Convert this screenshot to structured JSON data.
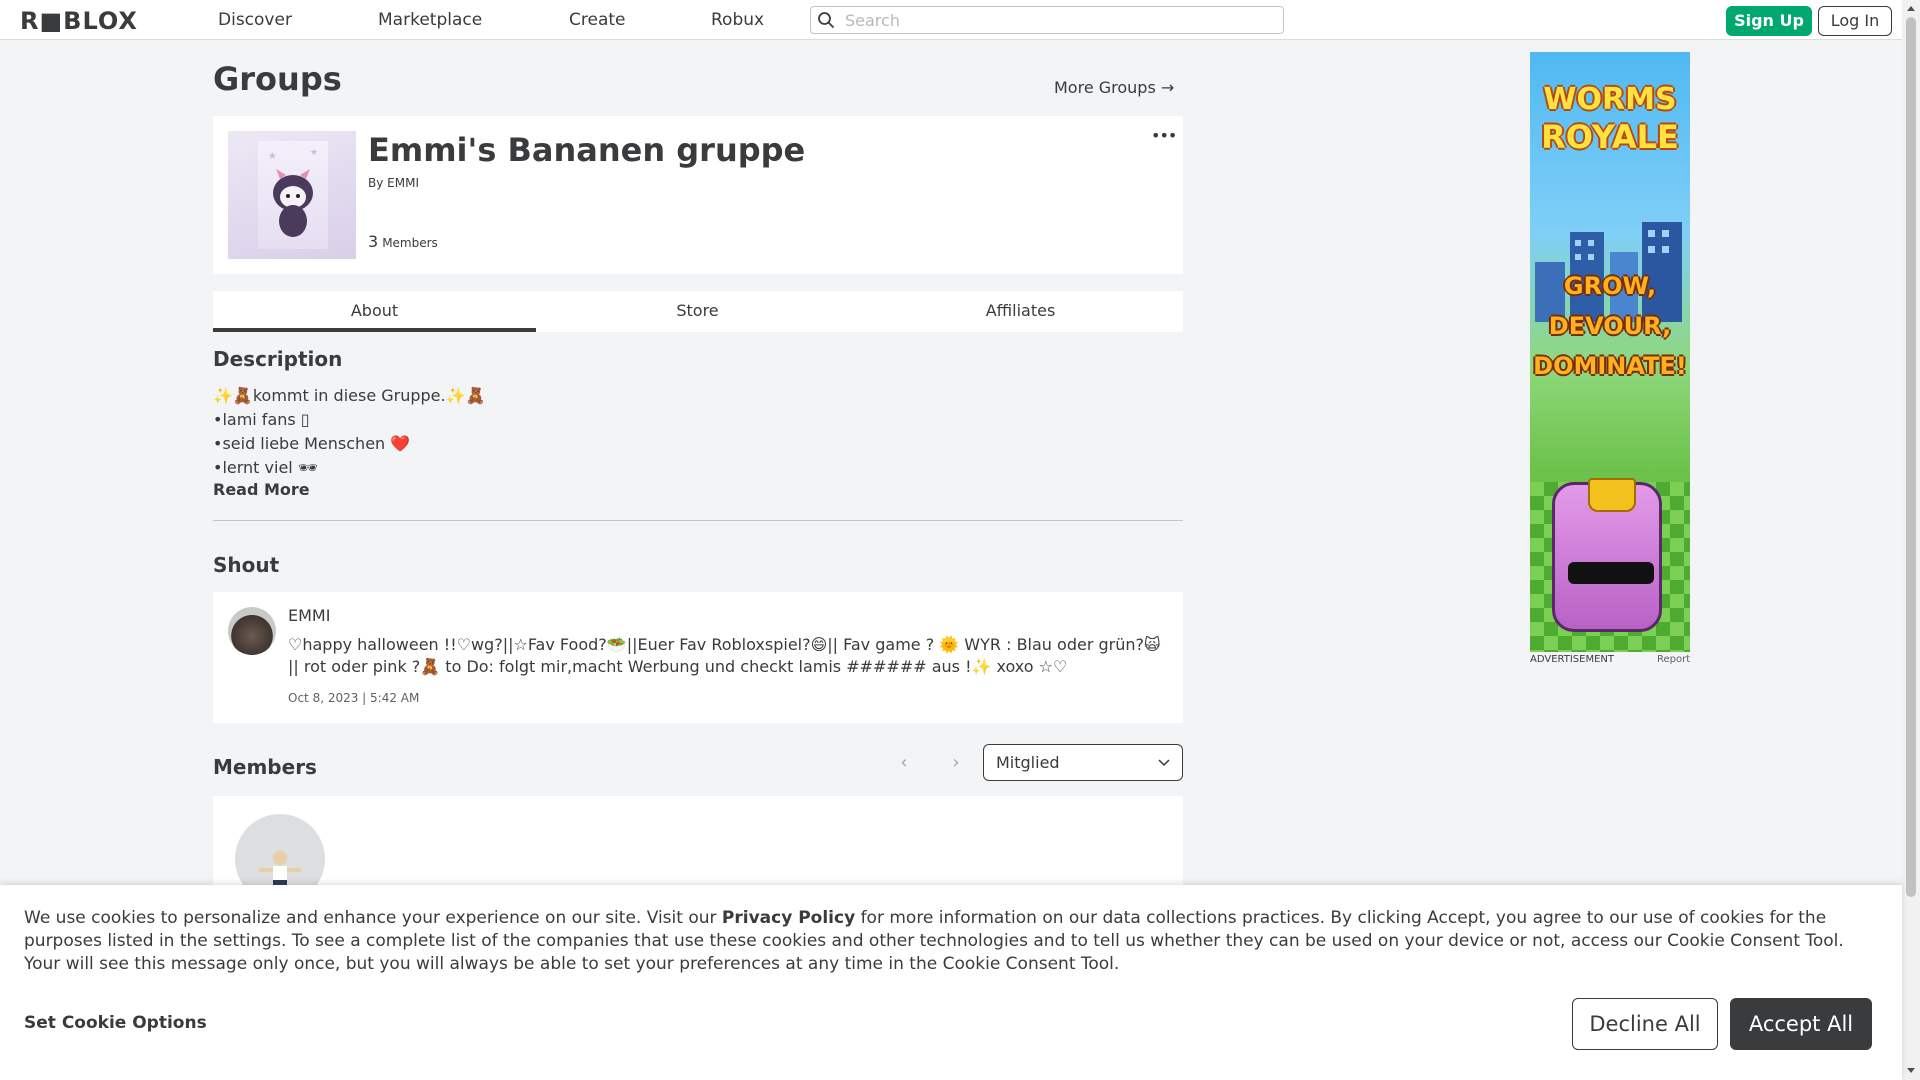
{
  "nav": {
    "logo": "R■BLOX",
    "links": [
      "Discover",
      "Marketplace",
      "Create",
      "Robux"
    ],
    "search_placeholder": "Search",
    "signup_label": "Sign Up",
    "login_label": "Log In"
  },
  "page": {
    "title": "Groups",
    "more_groups": "More Groups →"
  },
  "group": {
    "name": "Emmi's Bananen gruppe",
    "by_prefix": "By",
    "owner": "EMMI",
    "member_count": "3",
    "members_label": "Members",
    "menu_glyph": "•••"
  },
  "tabs": [
    "About",
    "Store",
    "Affiliates"
  ],
  "description": {
    "title": "Description",
    "lines": [
      "✨🧸kommt in diese Gruppe.✨🧸",
      "•lami fans ▯",
      "•seid liebe Menschen ❤️",
      "•lernt viel 🕶"
    ],
    "read_more": "Read More"
  },
  "shout": {
    "title": "Shout",
    "user": "EMMI",
    "text": "♡happy halloween !!♡wg?||☆Fav Food?🥗||Euer Fav Robloxspiel?😄|| Fav game ? 🌞 WYR : Blau oder grün?🙀 || rot oder pink ?🧸 to Do: folgt mir,macht Werbung und checkt lamis ###### aus !✨ xoxo ☆♡",
    "date": "Oct 8, 2023 | 5:42 AM"
  },
  "members": {
    "title": "Members",
    "rank_selected": "Mitglied"
  },
  "ad": {
    "title_line1": "WORMS",
    "title_line2": "ROYALE",
    "slogan": [
      "GROW,",
      "DEVOUR,",
      "DOMINATE!"
    ],
    "label": "ADVERTISEMENT",
    "report": "Report"
  },
  "cookie": {
    "text_before": "We use cookies to personalize and enhance your experience on our site. Visit our ",
    "privacy_link": "Privacy Policy",
    "text_after": " for more information on our data collections practices. By clicking Accept, you agree to our use of cookies for the purposes listed in the settings. To see a complete list of the companies that use these cookies and other technologies and to tell us whether they can be used on your device or not, access our Cookie Consent Tool. Your will see this message only once, but you will always be able to set your preferences at any time in the Cookie Consent Tool.",
    "set_options": "Set Cookie Options",
    "decline": "Decline All",
    "accept": "Accept All"
  },
  "colors": {
    "signup_green": "#00a870",
    "text_dark": "#393b3d",
    "page_bg": "#f2f4f5"
  }
}
